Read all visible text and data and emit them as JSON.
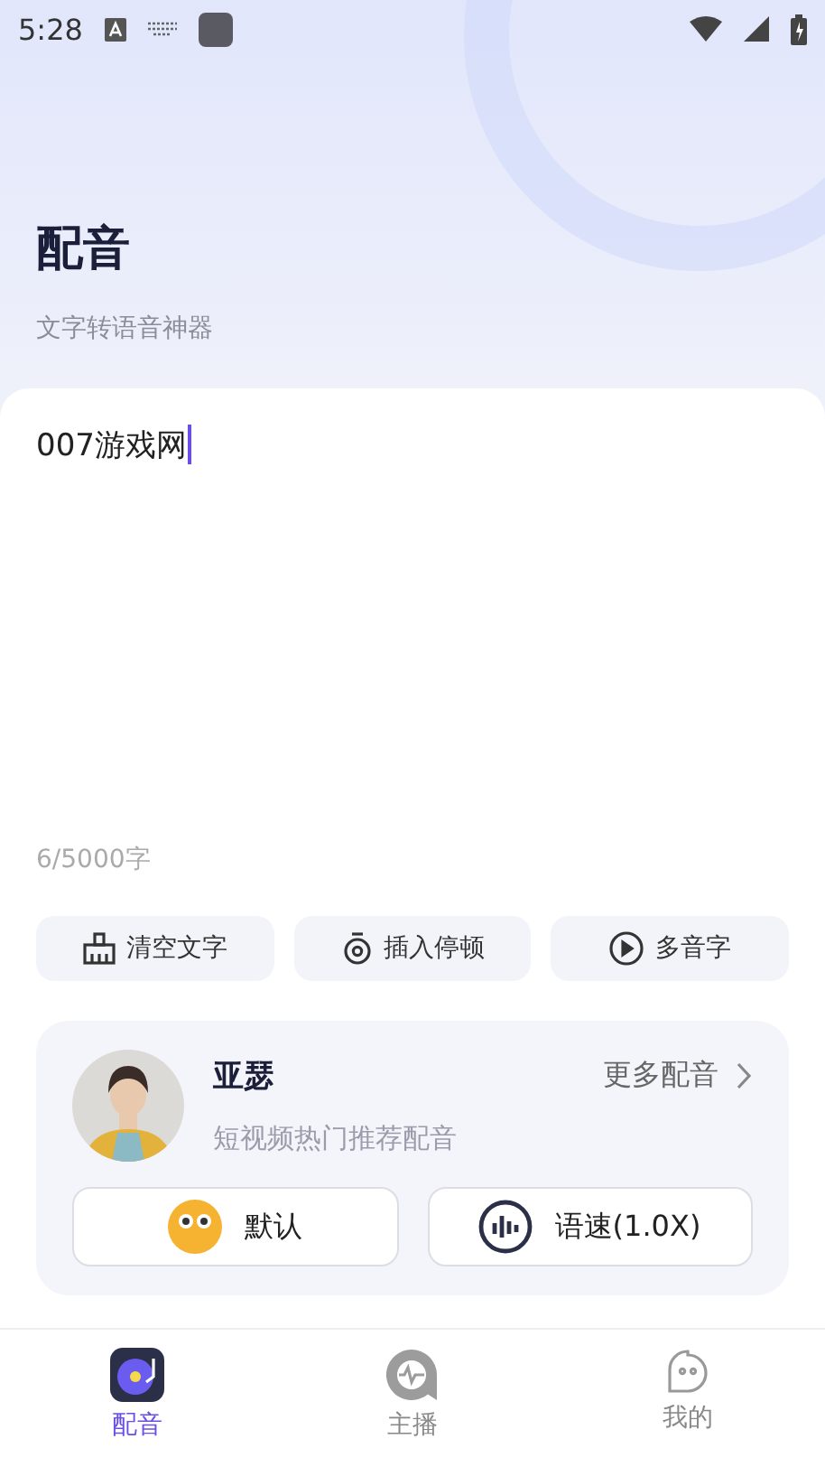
{
  "status_bar": {
    "time": "5:28"
  },
  "header": {
    "title": "配音",
    "subtitle": "文字转语音神器"
  },
  "editor": {
    "value": "007游戏网",
    "counter": "6/5000字"
  },
  "tools": [
    {
      "kind": "clear",
      "label": "清空文字"
    },
    {
      "kind": "pause",
      "label": "插入停顿"
    },
    {
      "kind": "polyphone",
      "label": "多音字"
    }
  ],
  "voice": {
    "name": "亚瑟",
    "description": "短视频热门推荐配音",
    "more": "更多配音"
  },
  "options": [
    {
      "kind": "emotion",
      "label": "默认"
    },
    {
      "kind": "speed",
      "label": "语速(1.0X)"
    }
  ],
  "tab_bar": [
    {
      "kind": "dub",
      "label": "配音",
      "selected": true
    },
    {
      "kind": "anchor",
      "label": "主播",
      "selected": false
    },
    {
      "kind": "mine",
      "label": "我的",
      "selected": false
    }
  ]
}
